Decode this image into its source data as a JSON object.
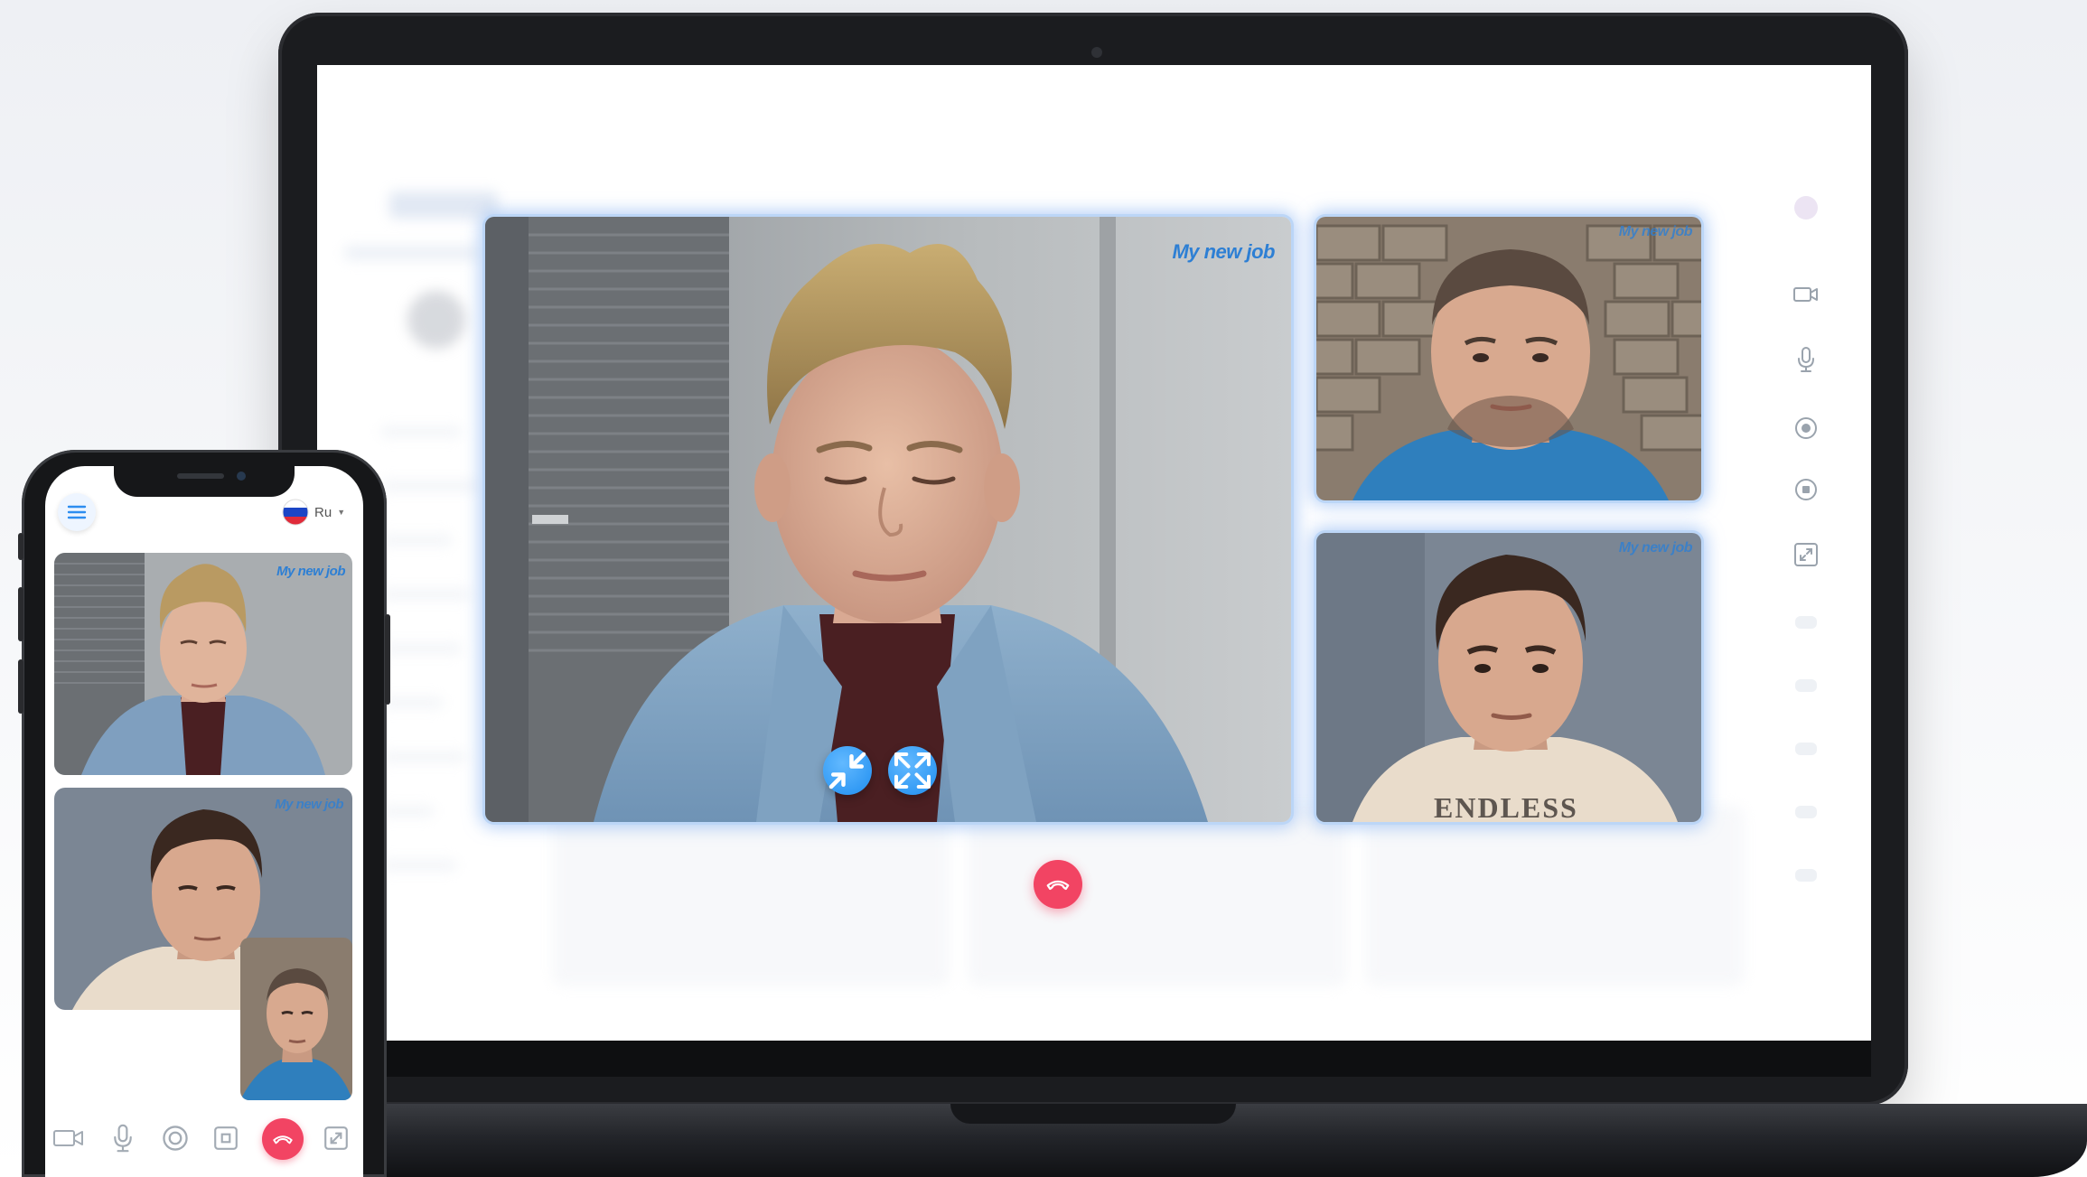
{
  "main_tile": {
    "watermark": "My new job"
  },
  "side_tiles": [
    {
      "watermark": "My new job"
    },
    {
      "watermark": "My new job"
    }
  ],
  "shirt_text": "ENDLESS",
  "phone": {
    "language": "Ru",
    "tile_watermarks": [
      "My new job",
      "My new job"
    ]
  },
  "icons": {
    "tile_controls": [
      "minimize-icon",
      "fullscreen-icon"
    ],
    "hangup": "phone-hangup-icon",
    "sidebar": [
      "video-camera-icon",
      "microphone-icon",
      "record-icon",
      "stop-icon",
      "exit-fullscreen-icon"
    ],
    "phone_toolbar": [
      "video-camera-icon",
      "microphone-icon",
      "record-icon",
      "stop-icon",
      "phone-hangup-icon",
      "fullscreen-icon"
    ]
  },
  "colors": {
    "accent": "#1f8ef0",
    "hangup": "#f24463",
    "watermark": "#2d7fd4",
    "tile_glow": "#bcd6f7"
  }
}
